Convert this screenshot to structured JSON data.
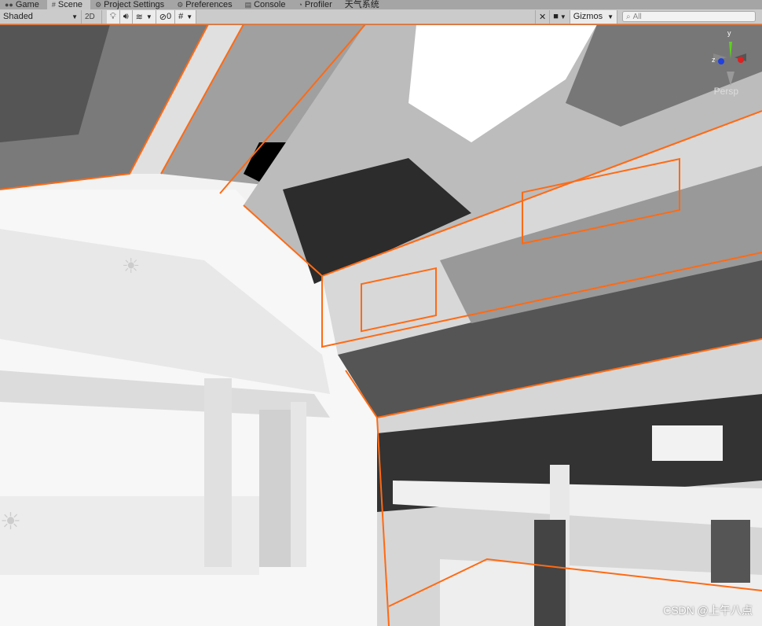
{
  "tabs": [
    {
      "label": "Game",
      "icon": "gamepad-icon"
    },
    {
      "label": "Scene",
      "icon": "grid-icon",
      "active": true
    },
    {
      "label": "Project Settings",
      "icon": "gear-icon"
    },
    {
      "label": "Preferences",
      "icon": "gear-icon"
    },
    {
      "label": "Console",
      "icon": "console-icon"
    },
    {
      "label": "Profiler",
      "icon": "profiler-icon"
    },
    {
      "label": "天气系统",
      "icon": ""
    }
  ],
  "toolbar": {
    "draw_mode": "Shaded",
    "mode_2d": "2D",
    "hidden_count": "0",
    "gizmos": "Gizmos",
    "search_placeholder": "All"
  },
  "gizmo": {
    "y_label": "y",
    "z_label": "z",
    "projection": "Persp"
  },
  "watermark": "CSDN @上午八点",
  "colors": {
    "selection_outline": "#ff6a13",
    "axis_x": "#e02020",
    "axis_y": "#5ed020",
    "axis_z": "#2040e0"
  }
}
